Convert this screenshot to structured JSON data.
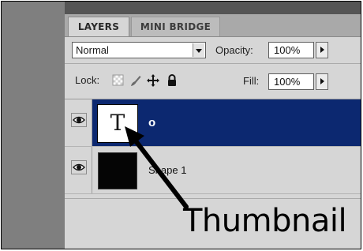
{
  "panel": {
    "tabs": [
      {
        "label": "LAYERS",
        "active": true
      },
      {
        "label": "MINI BRIDGE",
        "active": false
      }
    ],
    "blend_mode": {
      "value": "Normal"
    },
    "opacity": {
      "label": "Opacity:",
      "value": "100%"
    },
    "lock": {
      "label": "Lock:",
      "icons": [
        "lock-transparent-pixels-icon",
        "lock-image-pixels-icon",
        "lock-position-icon",
        "lock-all-icon"
      ]
    },
    "fill": {
      "label": "Fill:",
      "value": "100%"
    }
  },
  "layers": [
    {
      "name": "o",
      "type": "text",
      "thumbnail_glyph": "T",
      "visible": true,
      "selected": true
    },
    {
      "name": "Shape 1",
      "type": "shape",
      "visible": true,
      "selected": false
    }
  ],
  "annotation": {
    "label": "Thumbnail"
  },
  "colors": {
    "selected_row": "#0c2870",
    "panel_bg": "#d6d6d6",
    "dock_bg": "#7f7f7f",
    "arrow": "#000000"
  }
}
